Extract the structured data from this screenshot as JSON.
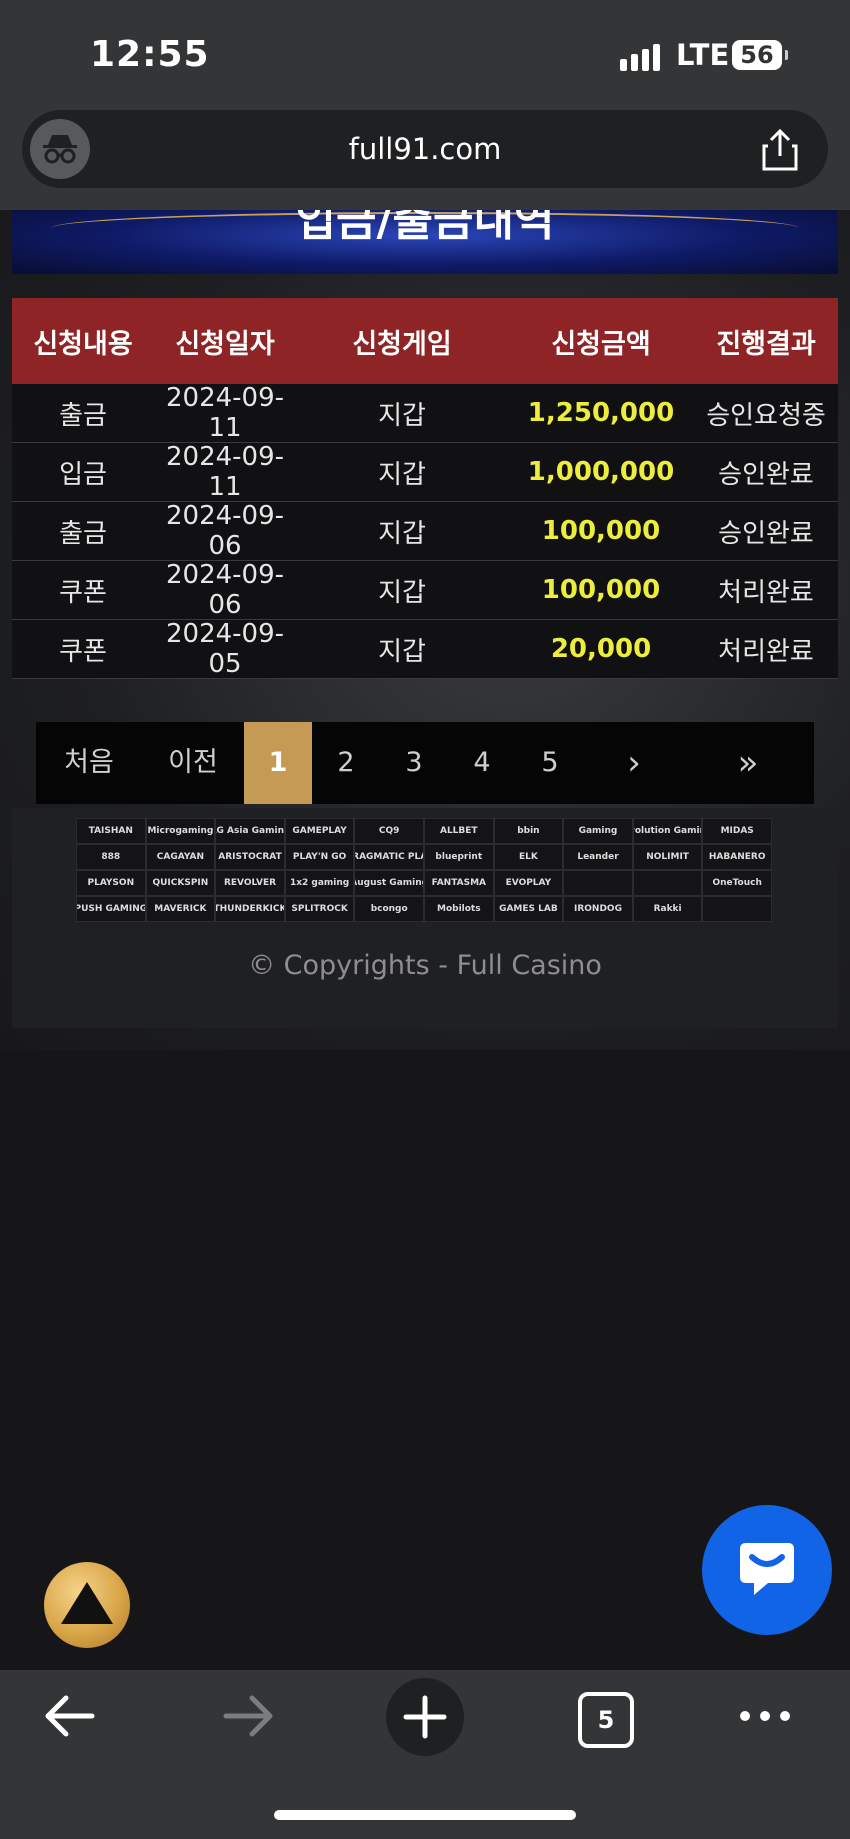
{
  "status": {
    "time": "12:55",
    "network": "LTE",
    "battery": "56"
  },
  "browser": {
    "url": "full91.com",
    "tab_count": "5"
  },
  "banner": {
    "title": "입금/출금내역"
  },
  "table": {
    "headers": [
      "신청내용",
      "신청일자",
      "신청게임",
      "신청금액",
      "진행결과"
    ],
    "rows": [
      {
        "type": "출금",
        "date": "2024-09-11",
        "game": "지갑",
        "amount": "1,250,000",
        "result": "승인요청중"
      },
      {
        "type": "입금",
        "date": "2024-09-11",
        "game": "지갑",
        "amount": "1,000,000",
        "result": "승인완료"
      },
      {
        "type": "출금",
        "date": "2024-09-06",
        "game": "지갑",
        "amount": "100,000",
        "result": "승인완료"
      },
      {
        "type": "쿠폰",
        "date": "2024-09-06",
        "game": "지갑",
        "amount": "100,000",
        "result": "처리완료"
      },
      {
        "type": "쿠폰",
        "date": "2024-09-05",
        "game": "지갑",
        "amount": "20,000",
        "result": "처리완료"
      }
    ]
  },
  "pager": {
    "first": "처음",
    "prev": "이전",
    "pages": [
      "1",
      "2",
      "3",
      "4",
      "5"
    ],
    "next": "›",
    "last": "»",
    "current": "1"
  },
  "providers": [
    "TAISHAN",
    "Microgaming",
    "AG Asia Gaming",
    "GAMEPLAY",
    "CQ9",
    "ALLBET",
    "bbin",
    "Gaming",
    "Evolution Gaming",
    "MIDAS",
    "888",
    "CAGAYAN",
    "ARISTOCRAT",
    "PLAY'N GO",
    "PRAGMATIC PLAY",
    "blueprint",
    "ELK",
    "Leander",
    "NOLIMIT",
    "HABANERO",
    "PLAYSON",
    "QUICKSPIN",
    "REVOLVER",
    "1x2 gaming",
    "August Gaming",
    "FANTASMA",
    "EVOPLAY",
    "",
    "",
    "OneTouch",
    "PUSH GAMING",
    "MAVERICK",
    "THUNDERKICK",
    "SPLITROCK",
    "bcongo",
    "Mobilots",
    "GAMES LAB",
    "IRONDOG",
    "Rakki",
    ""
  ],
  "footer": {
    "copyright": "© Copyrights - Full Casino"
  },
  "colors": {
    "header_red": "#8f2426",
    "amount_yellow": "#eded3c",
    "active_page": "#c49a55",
    "chat_blue": "#1164e6"
  }
}
